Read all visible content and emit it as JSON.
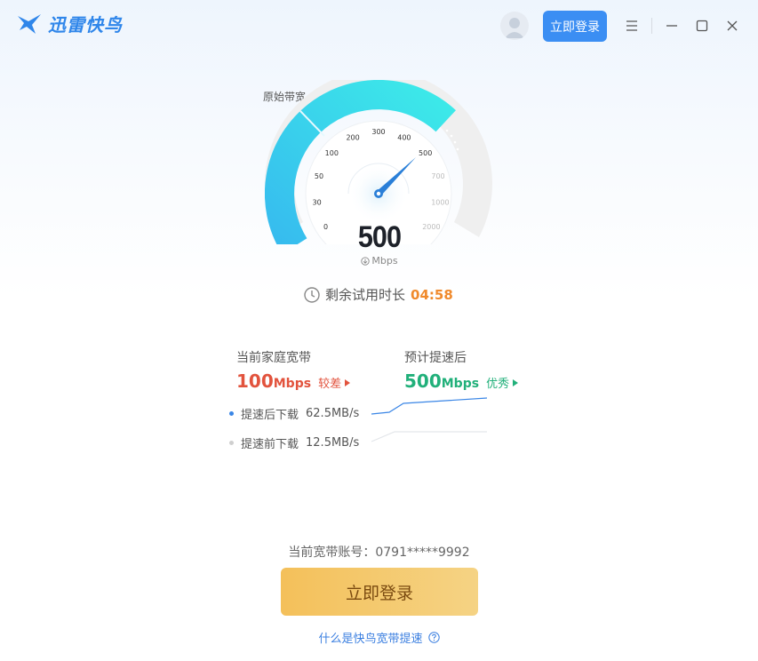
{
  "header": {
    "app_name": "迅雷快鸟",
    "login_button": "立即登录",
    "icons": [
      "bird-logo-icon",
      "user-avatar-icon",
      "menu-icon",
      "minimize-icon",
      "maximize-icon",
      "close-icon"
    ]
  },
  "gauge": {
    "original_label": "原始带宽",
    "ticks": [
      "0",
      "30",
      "50",
      "100",
      "200",
      "300",
      "400",
      "500",
      "700",
      "1000",
      "2000"
    ],
    "value": "500",
    "unit": "Mbps",
    "fill_to_tick": "500",
    "accent_color": "#3cc3f0"
  },
  "trial": {
    "label": "剩余试用时长",
    "time": "04:58"
  },
  "comparison": {
    "current": {
      "label": "当前家庭宽带",
      "value": "100",
      "unit": "Mbps",
      "rating": "较差",
      "color": "#e2533d"
    },
    "after": {
      "label": "预计提速后",
      "value": "500",
      "unit": "Mbps",
      "rating": "优秀",
      "color": "#21b07a"
    },
    "after_download": {
      "label": "提速后下载",
      "speed": "62.5MB/s"
    },
    "before_download": {
      "label": "提速前下载",
      "speed": "12.5MB/s"
    }
  },
  "footer": {
    "account_label": "当前宽带账号：",
    "account_value": "0791*****9992",
    "login_button": "立即登录",
    "help_link": "什么是快鸟宽带提速"
  }
}
